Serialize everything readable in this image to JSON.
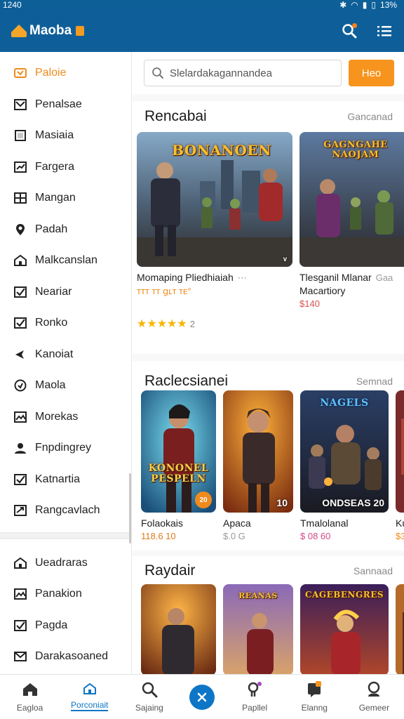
{
  "status_bar": {
    "time": "1240",
    "battery": "13%"
  },
  "app": {
    "name": "Maoba"
  },
  "sidebar": {
    "items": [
      {
        "label": "Paloie",
        "icon": "game-icon",
        "active": true
      },
      {
        "label": "Penalsae",
        "icon": "inbox-icon"
      },
      {
        "label": "Masiaia",
        "icon": "square-icon"
      },
      {
        "label": "Fargera",
        "icon": "chart-icon"
      },
      {
        "label": "Mangan",
        "icon": "grid-icon"
      },
      {
        "label": "Padah",
        "icon": "location-pin-icon"
      },
      {
        "label": "Malkcanslan",
        "icon": "store-icon"
      },
      {
        "label": "Neariar",
        "icon": "check-box-icon"
      },
      {
        "label": "Ronko",
        "icon": "check-box-icon"
      },
      {
        "label": "Kanoiat",
        "icon": "share-icon"
      },
      {
        "label": "Maola",
        "icon": "circle-icon"
      },
      {
        "label": "Morekas",
        "icon": "image-icon"
      },
      {
        "label": "Fnpdingrey",
        "icon": "user-icon"
      },
      {
        "label": "Katnartia",
        "icon": "check-box-icon"
      },
      {
        "label": "Rangcavlach",
        "icon": "swap-icon"
      }
    ],
    "secondary_items": [
      {
        "label": "Ueadraras",
        "icon": "store-icon"
      },
      {
        "label": "Panakion",
        "icon": "image-icon"
      },
      {
        "label": "Pagda",
        "icon": "check-box-icon"
      },
      {
        "label": "Darakasoaned",
        "icon": "mail-icon"
      }
    ]
  },
  "search": {
    "placeholder": "Slelardakagannandea",
    "button_label": "Heo"
  },
  "sections": [
    {
      "title": "Rencabai",
      "more": "Gancanad",
      "cards": [
        {
          "art_title": "BONANOEN",
          "name": "Momaping Pliedhiaiah",
          "price": "ᴛᴛᴛ ᴛᴛ 𝗀ʟᴛ ᴛᴇ°",
          "badge": "ᵥ",
          "menu": "⋯"
        },
        {
          "art_title": "GAGNGAHE NAOJAM",
          "name": "Tlesganil Mlanar",
          "name2": "Macartiory",
          "price": "$140",
          "menu": "Gaa"
        }
      ],
      "rating": {
        "stars": "★★★★★",
        "count": "2"
      }
    },
    {
      "title": "Raclecsianei",
      "more": "Semnad",
      "cards": [
        {
          "art_title": "KONONEL PESPELN",
          "name": "Folaokais",
          "price": "118.6 10",
          "badge": "20"
        },
        {
          "art_title": "",
          "name": "Apaca",
          "price": "$.0 G",
          "badge": "10"
        },
        {
          "art_title": "NAGELS",
          "name": "Tmalolanal",
          "price": "$ 08 60",
          "badge": "ONDSEAS 20"
        },
        {
          "art_title": "",
          "name": "Ku",
          "price": "$3"
        }
      ]
    },
    {
      "title": "Raydair",
      "more": "Sannaad",
      "cards": [
        {
          "art_title": ""
        },
        {
          "art_title": "REANAS"
        },
        {
          "art_title": "CAGEBENGRES"
        },
        {
          "art_title": ""
        }
      ]
    }
  ],
  "bottom_nav": [
    {
      "label": "Eagloa",
      "icon": "home-icon"
    },
    {
      "label": "Porconiait",
      "icon": "store-icon",
      "active": true
    },
    {
      "label": "Sajaing",
      "icon": "search-icon"
    },
    {
      "label": "",
      "icon": "close-icon"
    },
    {
      "label": "Papllel",
      "icon": "profile-icon"
    },
    {
      "label": "Elanng",
      "icon": "message-icon"
    },
    {
      "label": "Gemeer",
      "icon": "account-icon"
    }
  ],
  "colors": {
    "brand": "#0e5f99",
    "accent": "#f7941d",
    "link": "#0e76c6"
  }
}
